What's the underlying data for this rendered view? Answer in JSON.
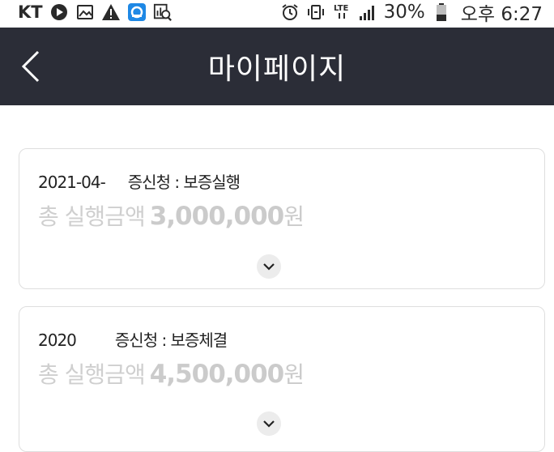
{
  "status_bar": {
    "carrier": "KT",
    "battery_percent": "30%",
    "clock": "오후 6:27",
    "icons": [
      "play-store-icon",
      "image-icon",
      "warning-icon",
      "app-icon",
      "gallery-search-icon",
      "alarm-icon",
      "vibrate-icon",
      "lte-icon",
      "signal-icon",
      "battery-icon"
    ]
  },
  "header": {
    "title": "마이페이지",
    "back_icon": "chevron-left-icon"
  },
  "cards": [
    {
      "date": "2021-04-",
      "apply_label": "보증신청 : 보증실행",
      "apply_visible": "증신청 : 보증실행",
      "amount_label": "총 실행금액",
      "amount": "3,000,000",
      "unit": "원"
    },
    {
      "date": "2020",
      "apply_label": "보증신청 : 보증체결",
      "apply_visible": "증신청 : 보증체결",
      "amount_label": "총 실행금액",
      "amount": "4,500,000",
      "unit": "원"
    }
  ],
  "colors": {
    "header_bg": "#2b2d37",
    "card_border": "#dedede",
    "amount_text": "#cbcbcb"
  }
}
